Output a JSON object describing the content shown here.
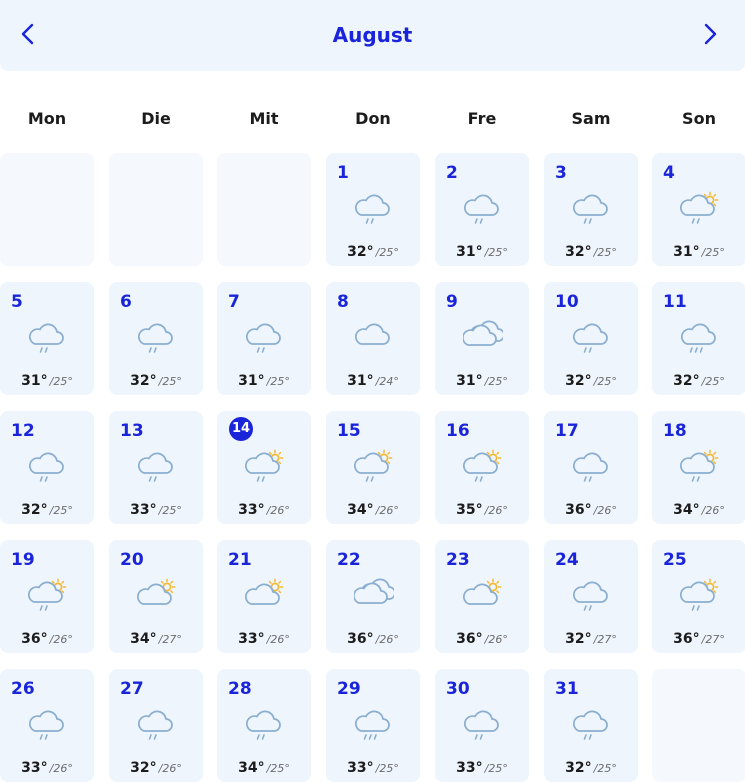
{
  "header": {
    "month": "August",
    "prev_icon": "chevron-left-icon",
    "next_icon": "chevron-right-icon"
  },
  "weekdays": [
    "Mon",
    "Die",
    "Mit",
    "Don",
    "Fre",
    "Sam",
    "Son"
  ],
  "today": "14",
  "colors": {
    "accent": "#1a24d9",
    "cell_bg": "#eef5fd",
    "cloud_stroke": "#8aaed0",
    "sun": "#f5b82e"
  },
  "leading_empty_cells": 3,
  "days": [
    {
      "day": "1",
      "icon": "cloud-rain-icon",
      "max": "32°",
      "min": "/25°"
    },
    {
      "day": "2",
      "icon": "cloud-rain-icon",
      "max": "31°",
      "min": "/25°"
    },
    {
      "day": "3",
      "icon": "cloud-rain-icon",
      "max": "32°",
      "min": "/25°"
    },
    {
      "day": "4",
      "icon": "sun-cloud-rain-icon",
      "max": "31°",
      "min": "/25°"
    },
    {
      "day": "5",
      "icon": "cloud-rain-icon",
      "max": "31°",
      "min": "/25°"
    },
    {
      "day": "6",
      "icon": "cloud-rain-icon",
      "max": "32°",
      "min": "/25°"
    },
    {
      "day": "7",
      "icon": "cloud-rain-icon",
      "max": "31°",
      "min": "/25°"
    },
    {
      "day": "8",
      "icon": "cloud-icon",
      "max": "31°",
      "min": "/24°"
    },
    {
      "day": "9",
      "icon": "clouds-icon",
      "max": "31°",
      "min": "/25°"
    },
    {
      "day": "10",
      "icon": "cloud-rain-icon",
      "max": "32°",
      "min": "/25°"
    },
    {
      "day": "11",
      "icon": "cloud-heavy-rain-icon",
      "max": "32°",
      "min": "/25°"
    },
    {
      "day": "12",
      "icon": "cloud-rain-icon",
      "max": "32°",
      "min": "/25°"
    },
    {
      "day": "13",
      "icon": "cloud-rain-icon",
      "max": "33°",
      "min": "/25°"
    },
    {
      "day": "14",
      "icon": "sun-cloud-rain-icon",
      "max": "33°",
      "min": "/26°"
    },
    {
      "day": "15",
      "icon": "sun-cloud-rain-icon",
      "max": "34°",
      "min": "/26°"
    },
    {
      "day": "16",
      "icon": "sun-cloud-rain-icon",
      "max": "35°",
      "min": "/26°"
    },
    {
      "day": "17",
      "icon": "cloud-rain-icon",
      "max": "36°",
      "min": "/26°"
    },
    {
      "day": "18",
      "icon": "sun-cloud-rain-icon",
      "max": "34°",
      "min": "/26°"
    },
    {
      "day": "19",
      "icon": "sun-cloud-rain-icon",
      "max": "36°",
      "min": "/26°"
    },
    {
      "day": "20",
      "icon": "sun-cloud-icon",
      "max": "34°",
      "min": "/27°"
    },
    {
      "day": "21",
      "icon": "sun-cloud-icon",
      "max": "33°",
      "min": "/26°"
    },
    {
      "day": "22",
      "icon": "clouds-icon",
      "max": "36°",
      "min": "/26°"
    },
    {
      "day": "23",
      "icon": "sun-cloud-icon",
      "max": "36°",
      "min": "/26°"
    },
    {
      "day": "24",
      "icon": "cloud-rain-icon",
      "max": "32°",
      "min": "/27°"
    },
    {
      "day": "25",
      "icon": "sun-cloud-rain-icon",
      "max": "36°",
      "min": "/27°"
    },
    {
      "day": "26",
      "icon": "cloud-rain-icon",
      "max": "33°",
      "min": "/26°"
    },
    {
      "day": "27",
      "icon": "cloud-rain-icon",
      "max": "32°",
      "min": "/26°"
    },
    {
      "day": "28",
      "icon": "cloud-rain-icon",
      "max": "34°",
      "min": "/25°"
    },
    {
      "day": "29",
      "icon": "cloud-heavy-rain-icon",
      "max": "33°",
      "min": "/25°"
    },
    {
      "day": "30",
      "icon": "cloud-rain-icon",
      "max": "33°",
      "min": "/25°"
    },
    {
      "day": "31",
      "icon": "cloud-rain-icon",
      "max": "32°",
      "min": "/25°"
    }
  ]
}
